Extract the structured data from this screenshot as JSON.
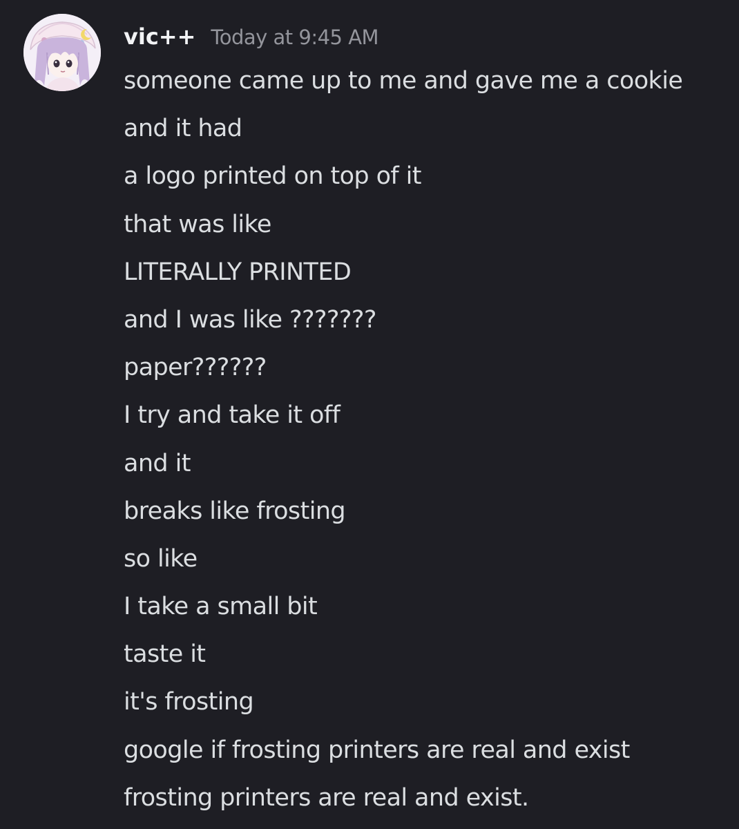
{
  "message": {
    "author": "vic++",
    "timestamp": "Today at 9:45 AM",
    "avatar_icon": "anime-girl-avatar-icon",
    "lines": [
      "someone came up to me and gave me a cookie",
      "and it had",
      "a logo printed on top of it",
      "that was like",
      "LITERALLY PRINTED",
      "and I was like ???????",
      "paper??????",
      "I try and take it off",
      "and it",
      "breaks like frosting",
      "so like",
      "I take a small bit",
      "taste it",
      "it's frosting",
      "google if frosting printers are real and exist",
      "frosting printers are real and exist."
    ]
  },
  "colors": {
    "background": "#1e1e24",
    "username": "#f2f3f5",
    "timestamp": "#94959c",
    "message_text": "#dbdee1"
  }
}
